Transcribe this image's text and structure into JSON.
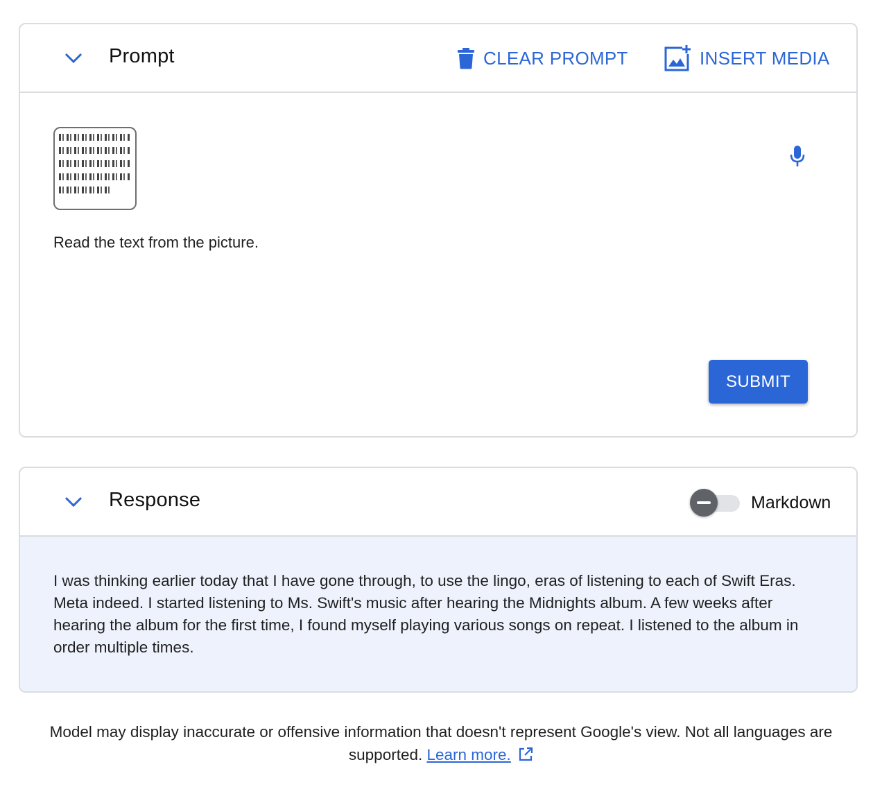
{
  "prompt": {
    "title": "Prompt",
    "clear_label": "CLEAR PROMPT",
    "insert_label": "INSERT MEDIA",
    "text": "Read the text from the picture.",
    "submit_label": "SUBMIT"
  },
  "response": {
    "title": "Response",
    "markdown_label": "Markdown",
    "markdown_enabled": false,
    "text": "I was thinking earlier today that I have gone through, to use the lingo, eras of listening to each of Swift Eras. Meta indeed. I started listening to Ms. Swift's music after hearing the Midnights album. A few weeks after hearing the album for the first time, I found myself playing various songs on repeat. I listened to the album in order multiple times."
  },
  "footer": {
    "disclaimer": "Model may display inaccurate or offensive information that doesn't represent Google's view. Not all languages are supported.",
    "learn_more": "Learn more."
  },
  "colors": {
    "accent": "#2b66d6",
    "response_bg": "#edf2fc",
    "border": "#dadce0"
  },
  "icons": {
    "collapse": "chevron-down-icon",
    "clear": "trash-icon",
    "insert": "add-image-icon",
    "mic": "microphone-icon",
    "external": "external-link-icon"
  }
}
